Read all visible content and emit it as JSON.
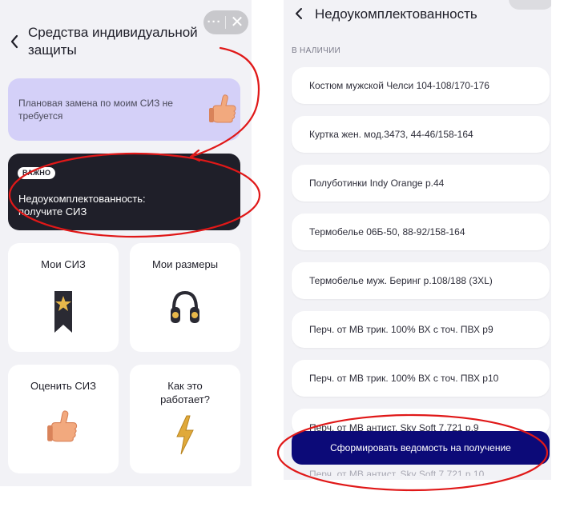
{
  "left": {
    "header": {
      "back_icon": "chevron-left-icon",
      "title": "Средства индивидуальной защиты"
    },
    "capsule": {
      "more_glyph": "···",
      "close_glyph": "✕"
    },
    "plan_card": {
      "text": "Плановая замена по моим СИЗ не требуется",
      "icon": "thumbs-up-icon"
    },
    "alert_card": {
      "badge": "ВАЖНО",
      "text": "Недоукомплектованность: получите СИЗ"
    },
    "tiles": [
      {
        "label": "Мои СИЗ",
        "icon": "bookmark-star-icon"
      },
      {
        "label": "Мои размеры",
        "icon": "headphones-icon"
      },
      {
        "label": "Оценить СИЗ",
        "icon": "thumbs-up-icon"
      },
      {
        "label": "Как это работает?",
        "icon": "lightning-icon"
      }
    ]
  },
  "right": {
    "header": {
      "back_icon": "chevron-left-icon",
      "title": "Недоукомплектованность"
    },
    "section_label": "В НАЛИЧИИ",
    "items": [
      "Костюм мужской Челси 104-108/170-176",
      "Куртка жен. мод.3473, 44-46/158-164",
      "Полуботинки Indy Orange р.44",
      "Термобелье 06Б-50, 88-92/158-164",
      "Термобелье муж. Беринг р.108/188 (3XL)",
      "Перч. от МВ трик. 100% ВХ с точ. ПВХ р9",
      "Перч. от МВ трик. 100% ВХ с точ. ПВХ р10",
      "Перч. от МВ антист. Sky Soft 7.721 р.9"
    ],
    "peek_item": "Перч. от МВ антист. Sky Soft 7.721 р.10",
    "submit_button": "Сформировать ведомость на получение"
  },
  "colors": {
    "background": "#f2f2f6",
    "card": "#ffffff",
    "plan_card": "#d4d0f8",
    "alert_card": "#1f1f29",
    "primary_button": "#0c0a78",
    "annotation": "#e01818"
  }
}
